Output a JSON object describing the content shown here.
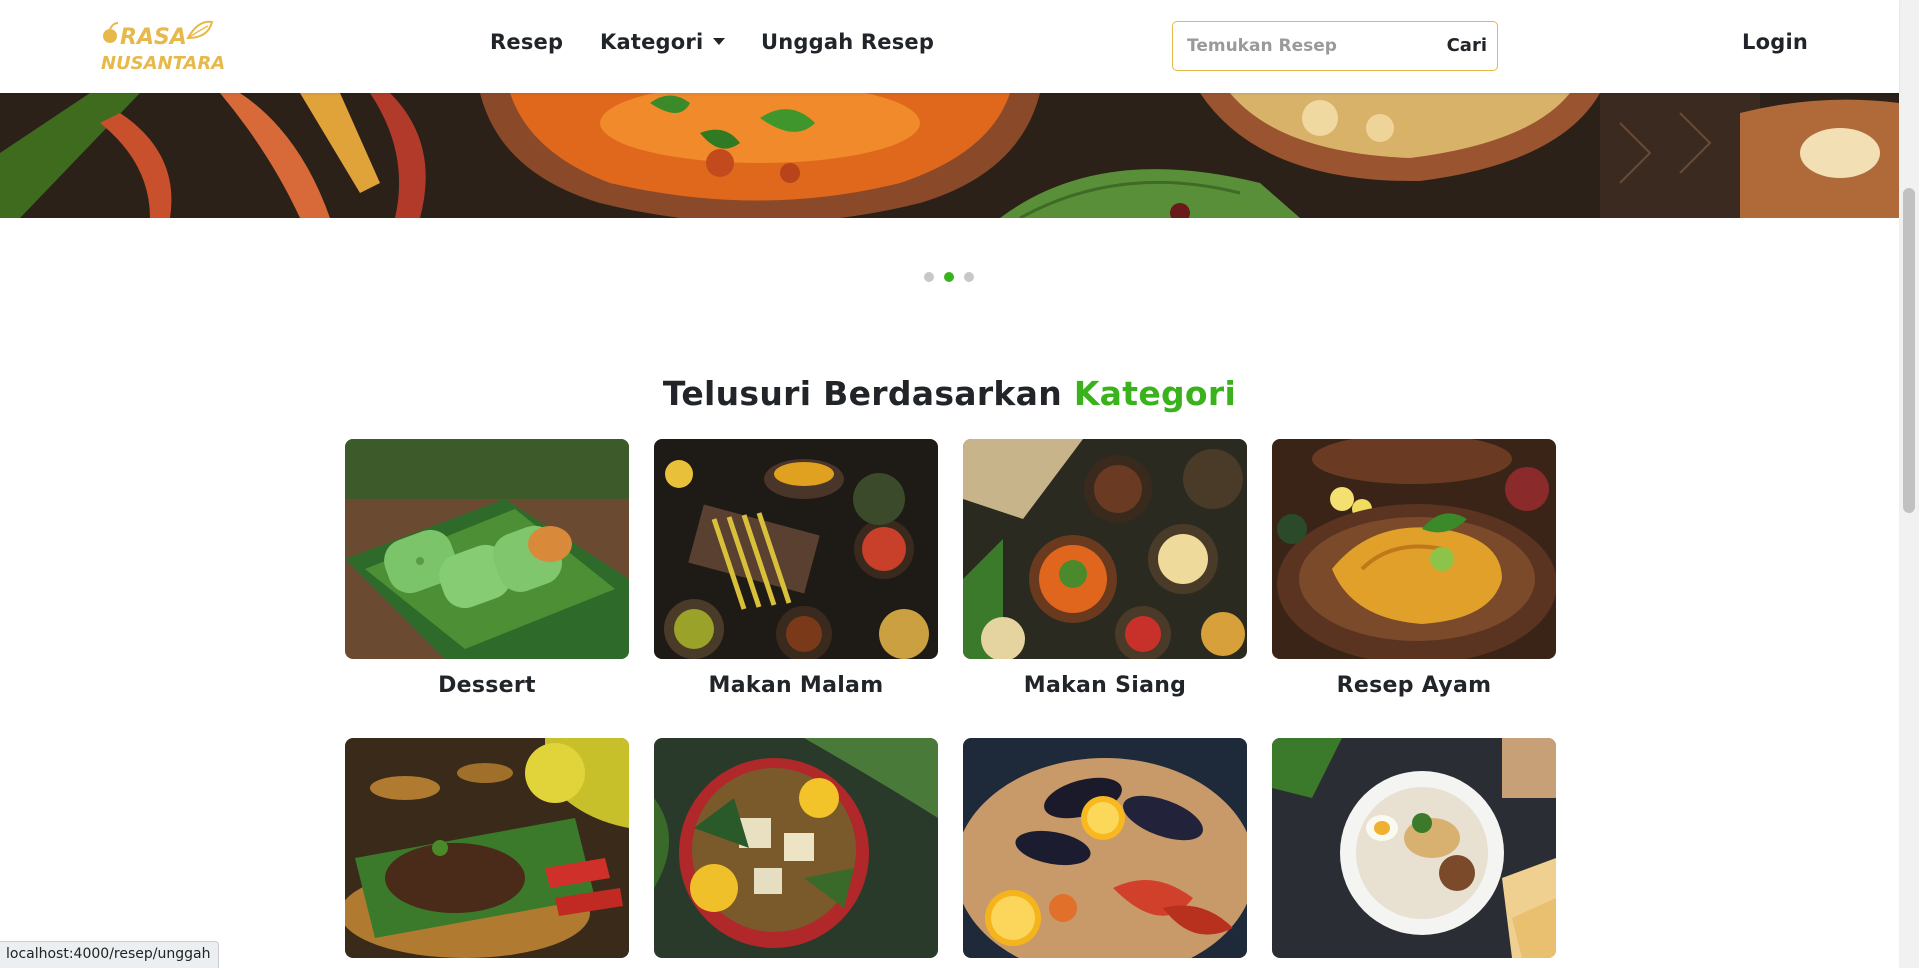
{
  "brand": {
    "line1": "RASA",
    "line2": "NUSANTARA",
    "color": "#e7b94a"
  },
  "nav": {
    "resep": "Resep",
    "kategori": "Kategori",
    "unggah": "Unggah Resep",
    "login": "Login"
  },
  "search": {
    "placeholder": "Temukan Resep",
    "value": "",
    "button": "Cari"
  },
  "carousel": {
    "slides": 3,
    "active_index": 1
  },
  "section": {
    "title_main": "Telusuri Berdasarkan",
    "title_accent": "Kategori"
  },
  "categories": [
    {
      "label": "Dessert"
    },
    {
      "label": "Makan Malam"
    },
    {
      "label": "Makan Siang"
    },
    {
      "label": "Resep Ayam"
    },
    {
      "label": ""
    },
    {
      "label": ""
    },
    {
      "label": ""
    },
    {
      "label": ""
    }
  ],
  "colors": {
    "accent": "#39b21b",
    "brand": "#e7b94a",
    "text": "#212529"
  },
  "status_bar": {
    "url": "localhost:4000/resep/unggah"
  }
}
